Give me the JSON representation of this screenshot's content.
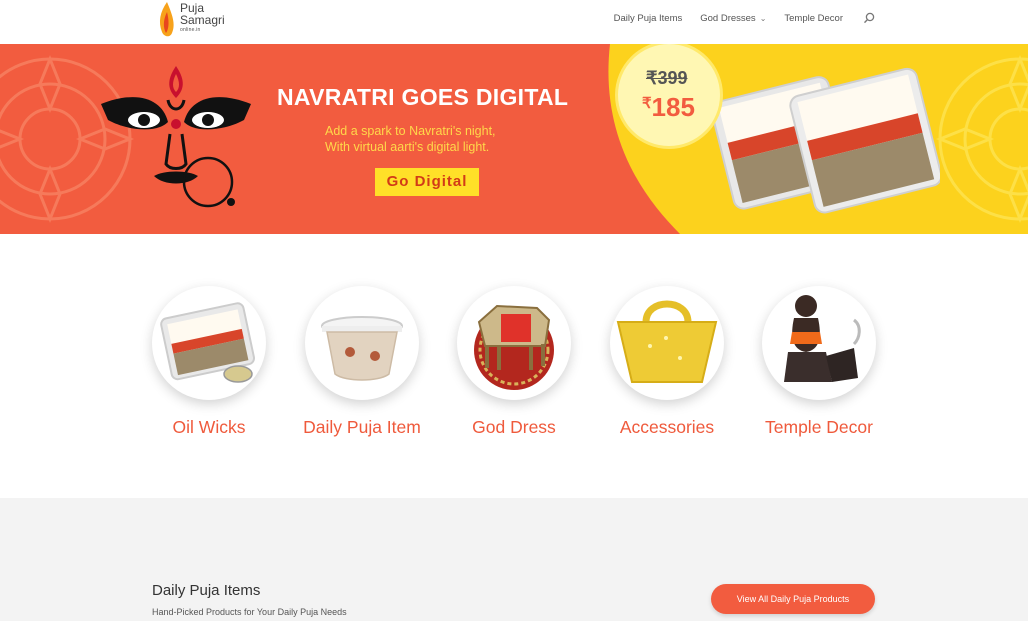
{
  "brand": {
    "logo_line1": "Puja",
    "logo_line2": "Samagri",
    "logo_sub": "online.in"
  },
  "nav": {
    "items": [
      {
        "label": "Daily Puja Items"
      },
      {
        "label": "God Dresses"
      },
      {
        "label": "Temple Decor"
      }
    ],
    "search_icon": "search-icon",
    "dropdown_icon": "chevron-down-icon"
  },
  "banner": {
    "title": "NAVRATRI GOES DIGITAL",
    "subtitle_line1": "Add a spark to Navratri's night,",
    "subtitle_line2": "With virtual aarti's digital light.",
    "cta_label": "Go Digital",
    "price_old": "₹399",
    "price_new_symbol": "₹",
    "price_new_amount": "185",
    "colors": {
      "primary": "#f25c3f",
      "yellow": "#fcd21d",
      "cta_bg": "#ffe028"
    }
  },
  "categories": [
    {
      "label": "Oil Wicks"
    },
    {
      "label": "Daily Puja Item"
    },
    {
      "label": "God Dress"
    },
    {
      "label": "Accessories"
    },
    {
      "label": "Temple Decor"
    }
  ],
  "section": {
    "title": "Daily Puja Items",
    "subtitle": "Hand-Picked Products for Your Daily Puja Needs",
    "button_label": "View All Daily Puja Products"
  }
}
